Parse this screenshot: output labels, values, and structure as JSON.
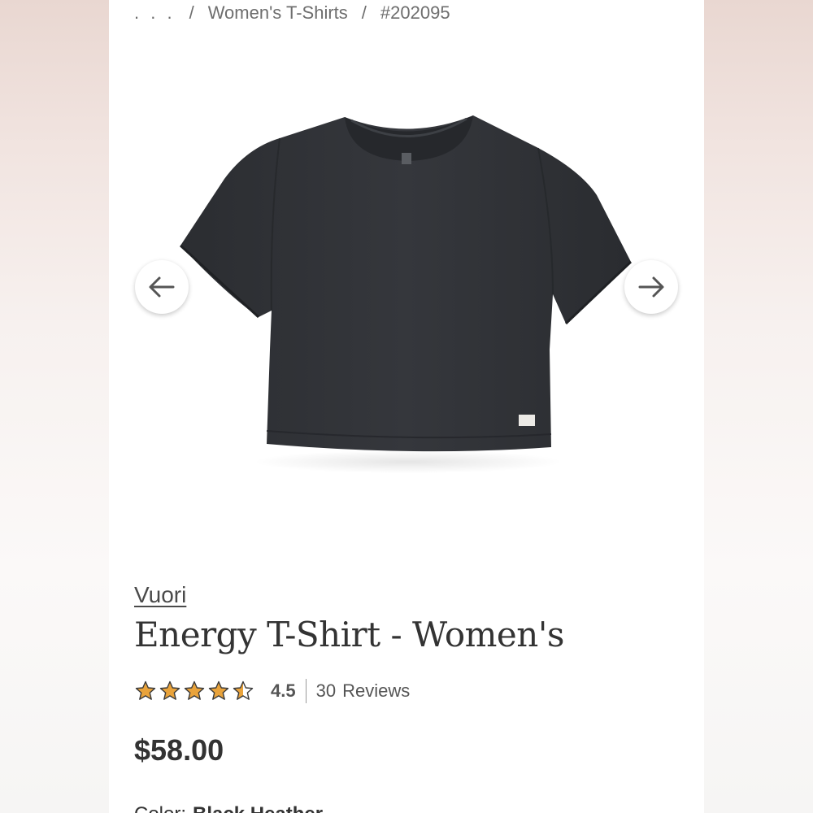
{
  "breadcrumb": {
    "ellipsis": ". . .",
    "separator": "/",
    "category": "Women's T-Shirts",
    "item_number": "#202095"
  },
  "gallery": {
    "image_alt": "Black Heather Energy T-Shirt",
    "prev_icon": "arrow-left-icon",
    "next_icon": "arrow-right-icon"
  },
  "product": {
    "brand": "Vuori",
    "title": "Energy T-Shirt - Women's",
    "rating_value": "4.5",
    "rating_stars": 4.5,
    "review_count": "30",
    "review_label": "Reviews",
    "price": "$58.00",
    "color_label": "Color:",
    "color_value": "Black Heather"
  },
  "colors": {
    "star": "#e9a33b",
    "text": "#333333",
    "muted": "#6e6e6e"
  }
}
